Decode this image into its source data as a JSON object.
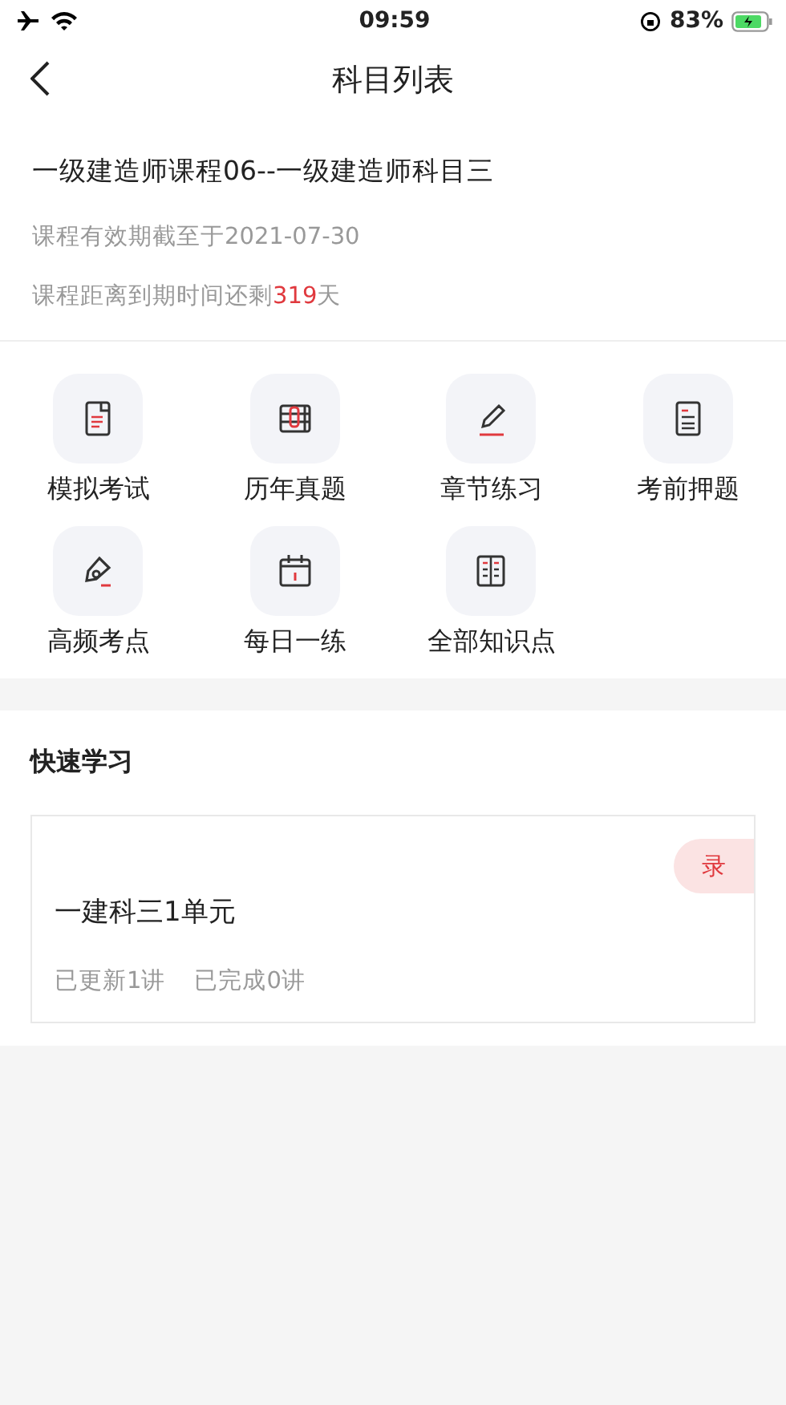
{
  "status_bar": {
    "time": "09:59",
    "battery_percent": "83%"
  },
  "nav": {
    "title": "科目列表"
  },
  "course": {
    "title": "一级建造师课程06--一级建造师科目三",
    "validity": "课程有效期截至于2021-07-30",
    "remaining_prefix": "课程距离到期时间还剩",
    "remaining_days": "319",
    "remaining_suffix": "天"
  },
  "features": [
    {
      "label": "模拟考试"
    },
    {
      "label": "历年真题"
    },
    {
      "label": "章节练习"
    },
    {
      "label": "考前押题"
    },
    {
      "label": "高频考点"
    },
    {
      "label": "每日一练"
    },
    {
      "label": "全部知识点"
    }
  ],
  "quick_study": {
    "title": "快速学习",
    "cards": [
      {
        "badge": "录",
        "title": "一建科三1单元",
        "updated": "已更新1讲",
        "completed": "已完成0讲"
      }
    ]
  }
}
